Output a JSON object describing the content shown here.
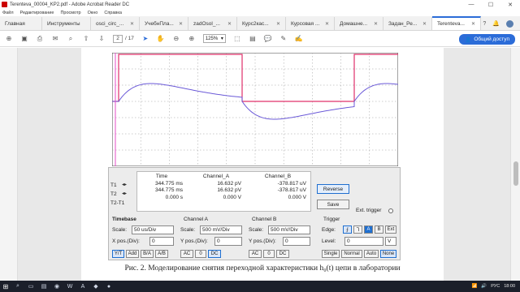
{
  "window": {
    "title": "Terenteva_00004_KP2.pdf - Adobe Acrobat Reader DC",
    "minimize": "—",
    "maximize": "☐",
    "close": "✕"
  },
  "menu": [
    "Файл",
    "Редактирование",
    "Просмотр",
    "Окно",
    "Справка"
  ],
  "tabs": {
    "home": "Главная",
    "tools": "Инструменты",
    "docs": [
      {
        "label": "osci_circ_..."
      },
      {
        "label": "УчебнПла..."
      },
      {
        "label": "zadOsol_..."
      },
      {
        "label": "Курс2кас..."
      },
      {
        "label": "Курсовая ..."
      },
      {
        "label": "Домашне..."
      },
      {
        "label": "Задан_Ре..."
      },
      {
        "label": "Terenteva..."
      }
    ],
    "close_glyph": "✕"
  },
  "toolbar": {
    "page_current": "2",
    "page_total": "/ 17",
    "zoom": "125%",
    "share_label": "Общий доступ"
  },
  "scope": {
    "colors": {
      "channel_a": "#e0306a",
      "channel_b": "#6b5ad8",
      "grid": "#9a9a9a",
      "t1": "#e64ec8"
    }
  },
  "panel": {
    "row_labels": [
      "T1",
      "T2",
      "T2-T1"
    ],
    "readout": {
      "headers": [
        "Time",
        "Channel_A",
        "Channel_B"
      ],
      "time": [
        "344.775 ms",
        "344.775 ms",
        "0.000 s"
      ],
      "channel_a": [
        "16.632 pV",
        "16.632 pV",
        "0.000 V"
      ],
      "channel_b": [
        "-378.817 uV",
        "-378.817 uV",
        "0.000 V"
      ]
    },
    "reverse_label": "Reverse",
    "save_label": "Save",
    "ext_trigger_label": "Ext. trigger",
    "timebase": {
      "title": "Timebase",
      "scale_label": "Scale:",
      "scale_value": "50 us/Div",
      "xpos_label": "X pos.(Div):",
      "xpos_value": "0",
      "modes": [
        "Y/T",
        "Add",
        "B/A",
        "A/B"
      ]
    },
    "channel_a": {
      "title": "Channel A",
      "scale_label": "Scale:",
      "scale_value": "500 mV/Div",
      "ypos_label": "Y pos.(Div):",
      "ypos_value": "0",
      "coupling": [
        "AC",
        "0",
        "DC"
      ]
    },
    "channel_b": {
      "title": "Channel B",
      "scale_label": "Scale:",
      "scale_value": "500 mV/Div",
      "ypos_label": "Y pos.(Div):",
      "ypos_value": "0",
      "coupling": [
        "AC",
        "0",
        "DC"
      ]
    },
    "trigger": {
      "title": "Trigger",
      "edge_label": "Edge:",
      "edge_buttons": [
        "A",
        "B",
        "Ext"
      ],
      "level_label": "Level:",
      "level_value": "0",
      "level_unit": "V",
      "modes": [
        "Single",
        "Normal",
        "Auto",
        "None"
      ]
    }
  },
  "caption": "Рис. 2. Моделирование снятия переходной характеристики h₀(t) цепи в лаборатории",
  "taskbar": {
    "lang": "РУС",
    "time": "18:00"
  }
}
